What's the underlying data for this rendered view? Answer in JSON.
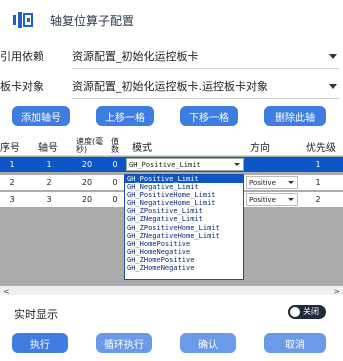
{
  "title": "轴复位算子配置",
  "fields": {
    "reference_label": "引用依赖",
    "reference_value": "资源配置_初始化运控板卡",
    "card_label": "板卡对象",
    "card_value": "资源配置_初始化运控板卡.运控板卡对象"
  },
  "toolbar": {
    "add": "添加轴号",
    "up": "上移一格",
    "down": "下移一格",
    "delete": "删除此轴"
  },
  "table": {
    "headers": {
      "index": "序号",
      "axis": "轴号",
      "speed": "速度(毫秒)",
      "accel": "值数",
      "mode": "模式",
      "direction": "方向",
      "priority": "优先级"
    },
    "rows": [
      {
        "index": "1",
        "axis": "1",
        "speed": "20",
        "accel": "0",
        "mode": "GH_Positive_Limit",
        "direction": "",
        "priority": "1"
      },
      {
        "index": "2",
        "axis": "2",
        "speed": "20",
        "accel": "0",
        "mode": "",
        "direction": "Positive",
        "priority": "1"
      },
      {
        "index": "3",
        "axis": "3",
        "speed": "20",
        "accel": "0",
        "mode": "",
        "direction": "Positive",
        "priority": "2"
      }
    ],
    "row1_direction_partial": ""
  },
  "mode_options": [
    "GH_Positive_Limit",
    "GH_Negative_Limit",
    "GH_PositiveHome_Limit",
    "GH_NegativeHome_Limit",
    "GH_ZPositive_Limit",
    "GH_ZNegative_Limit",
    "GH_ZPositiveHome_Limit",
    "GH_ZNegativeHome_Limit",
    "GH_HomePositive",
    "GH_HomeNegative",
    "GH_ZHomePositive",
    "GH_ZHomeNegative"
  ],
  "realtime": {
    "label": "实时显示",
    "toggle_text": "关闭"
  },
  "footer": {
    "execute": "执行",
    "loop": "循环执行",
    "confirm": "确认",
    "cancel": "取消"
  },
  "colors": {
    "primary": "#3f7de0",
    "selected_row": "#0d56c8"
  }
}
